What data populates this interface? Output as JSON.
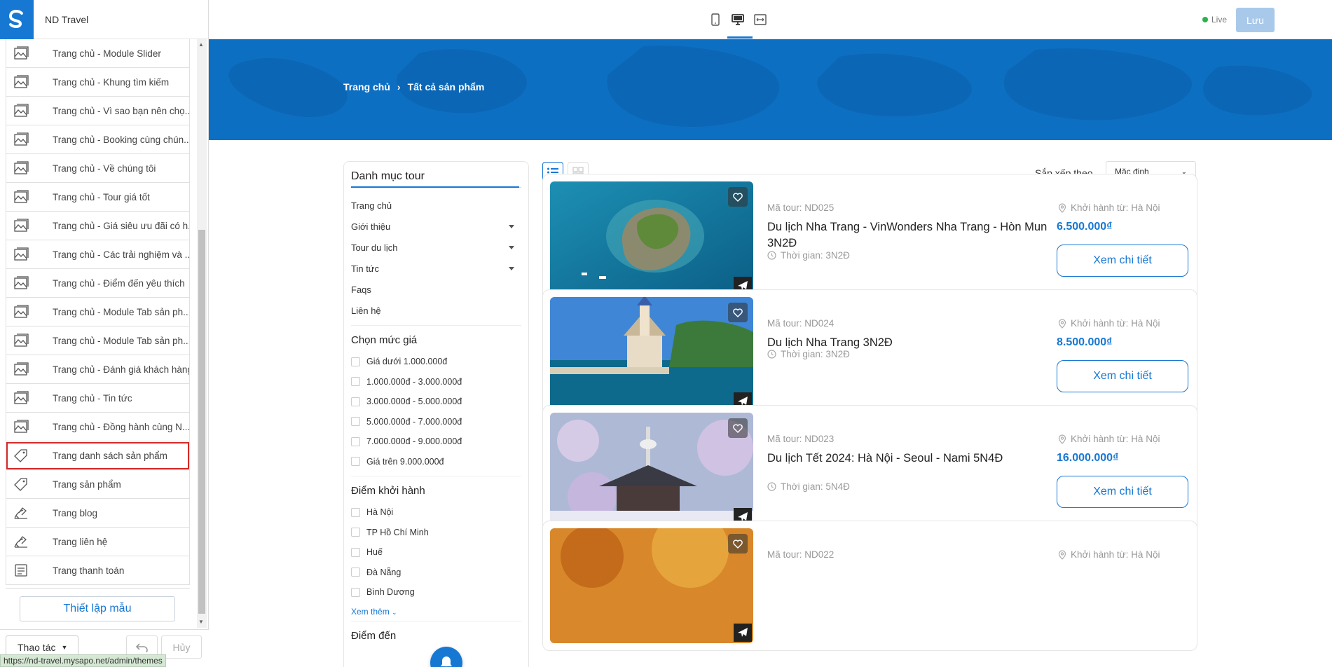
{
  "app": {
    "title": "ND Travel",
    "live_label": "Live",
    "save_label": "Lưu"
  },
  "sidebar": {
    "items": [
      {
        "label": "Trang chủ - Module Slider",
        "icon": "image-icon"
      },
      {
        "label": "Trang chủ - Khung tìm kiếm",
        "icon": "image-icon"
      },
      {
        "label": "Trang chủ - Vì sao bạn nên chọ...",
        "icon": "image-icon"
      },
      {
        "label": "Trang chủ - Booking cùng chún...",
        "icon": "image-icon"
      },
      {
        "label": "Trang chủ - Về chúng tôi",
        "icon": "image-icon"
      },
      {
        "label": "Trang chủ - Tour giá tốt",
        "icon": "image-icon"
      },
      {
        "label": "Trang chủ - Giá siêu ưu đãi có h...",
        "icon": "image-icon"
      },
      {
        "label": "Trang chủ - Các trải nghiệm và ...",
        "icon": "image-icon"
      },
      {
        "label": "Trang chủ - Điểm đến yêu thích",
        "icon": "image-icon"
      },
      {
        "label": "Trang chủ - Module Tab sản ph...",
        "icon": "image-icon"
      },
      {
        "label": "Trang chủ - Module Tab sản ph...",
        "icon": "image-icon"
      },
      {
        "label": "Trang chủ - Đánh giá khách hàng",
        "icon": "image-icon"
      },
      {
        "label": "Trang chủ - Tin tức",
        "icon": "image-icon"
      },
      {
        "label": "Trang chủ - Đồng hành cùng N...",
        "icon": "image-icon"
      },
      {
        "label": "Trang danh sách sản phẩm",
        "icon": "tag-icon",
        "selected": true
      },
      {
        "label": "Trang sản phẩm",
        "icon": "tag-icon"
      },
      {
        "label": "Trang blog",
        "icon": "blog-icon"
      },
      {
        "label": "Trang liên hệ",
        "icon": "blog-icon"
      },
      {
        "label": "Trang thanh toán",
        "icon": "payment-icon"
      }
    ],
    "setup_button": "Thiết lập mẫu",
    "action_button": "Thao tác",
    "cancel_button": "Hủy"
  },
  "status_url": "https://nd-travel.mysapo.net/admin/themes",
  "preview": {
    "breadcrumb": {
      "home": "Trang chủ",
      "current": "Tất cả sản phẩm"
    },
    "categories": {
      "title": "Danh mục tour",
      "items": [
        {
          "label": "Trang chủ",
          "has_caret": false
        },
        {
          "label": "Giới thiệu",
          "has_caret": true
        },
        {
          "label": "Tour du lịch",
          "has_caret": true
        },
        {
          "label": "Tin tức",
          "has_caret": true
        },
        {
          "label": "Faqs",
          "has_caret": false
        },
        {
          "label": "Liên hệ",
          "has_caret": false
        }
      ]
    },
    "price_filter": {
      "title": "Chọn mức giá",
      "options": [
        "Giá dưới 1.000.000đ",
        "1.000.000đ - 3.000.000đ",
        "3.000.000đ - 5.000.000đ",
        "5.000.000đ - 7.000.000đ",
        "7.000.000đ - 9.000.000đ",
        "Giá trên 9.000.000đ"
      ]
    },
    "departure_filter": {
      "title": "Điểm khởi hành",
      "options": [
        "Hà Nội",
        "TP Hồ Chí Minh",
        "Huế",
        "Đà Nẵng",
        "Bình Dương"
      ],
      "more": "Xem thêm"
    },
    "destination_title": "Điểm đến",
    "sort": {
      "label": "Sắp xếp theo",
      "value": "Mặc định"
    },
    "products": [
      {
        "code": "Mã tour: ND025",
        "name": "Du lịch Nha Trang - VinWonders Nha Trang - Hòn Mun 3N2Đ",
        "duration": "Thời gian: 3N2Đ",
        "departure": "Khởi hành từ: Hà Nội",
        "price": "6.500.000₫",
        "button": "Xem chi tiết"
      },
      {
        "code": "Mã tour: ND024",
        "name": "Du lịch Nha Trang 3N2Đ",
        "duration": "Thời gian: 3N2Đ",
        "departure": "Khởi hành từ: Hà Nội",
        "price": "8.500.000₫",
        "button": "Xem chi tiết"
      },
      {
        "code": "Mã tour: ND023",
        "name": "Du lịch Tết 2024: Hà Nội - Seoul - Nami 5N4Đ",
        "duration": "Thời gian: 5N4Đ",
        "departure": "Khởi hành từ: Hà Nội",
        "price": "16.000.000₫",
        "button": "Xem chi tiết"
      },
      {
        "code": "Mã tour: ND022",
        "name": "",
        "duration": "",
        "departure": "Khởi hành từ: Hà Nội",
        "price": "",
        "button": ""
      }
    ]
  },
  "colors": {
    "accent": "#1778d3",
    "hero": "#0d6fc2",
    "selected_outline": "#d42a2a",
    "live_dot": "#2bb24c"
  }
}
